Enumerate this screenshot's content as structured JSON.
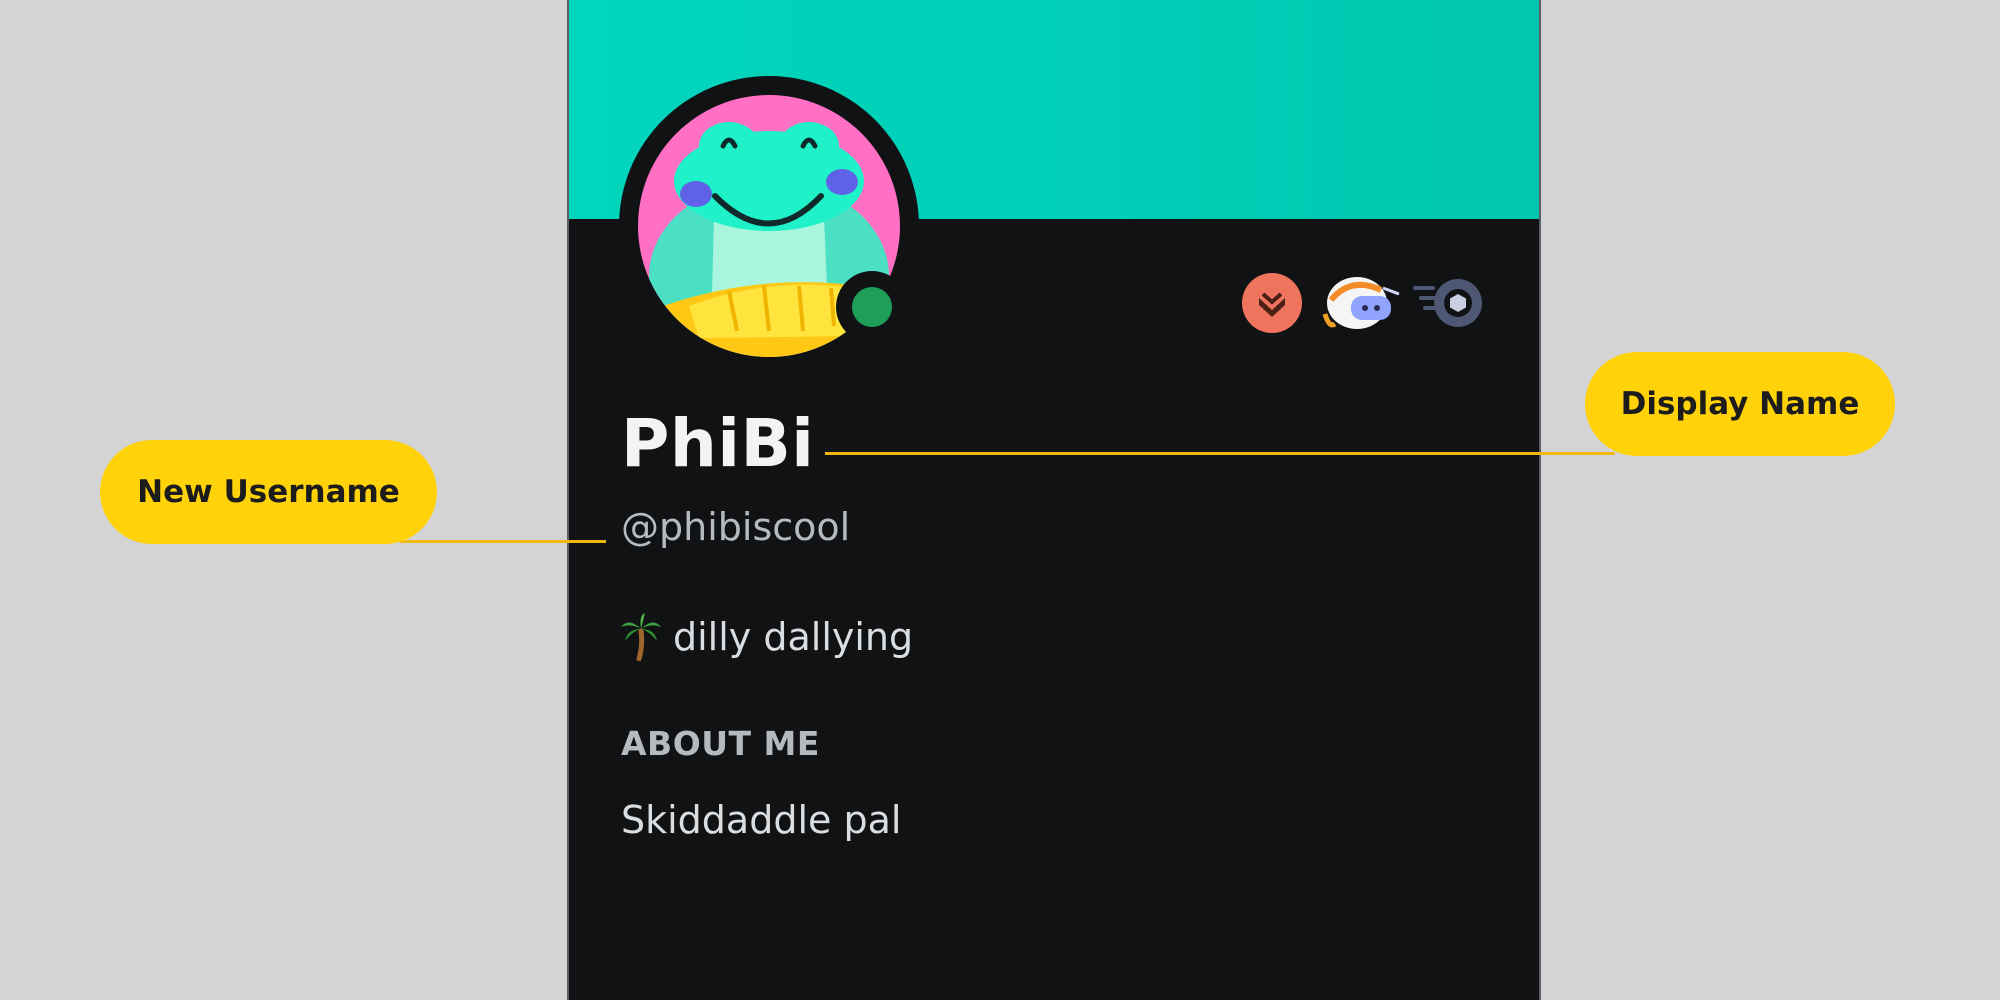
{
  "profile": {
    "display_name": "PhiBi",
    "username": "@phibiscool",
    "custom_status": {
      "emoji_icon": "palm-tree-icon",
      "text": "dilly dallying"
    },
    "about_me": {
      "heading": "ABOUT ME",
      "text": "Skiddaddle pal"
    },
    "online_status": "online",
    "badges": [
      "hypesquad-bravery-icon",
      "quest-helmet-icon",
      "nitro-badge-icon"
    ]
  },
  "callouts": {
    "display_name_label": "Display Name",
    "new_username_label": "New Username"
  },
  "colors": {
    "banner": "#00d6bd",
    "card_background": "#111214",
    "page_background": "#d4d4d4",
    "callout": "#ffd20a",
    "online": "#1f9e5a"
  }
}
